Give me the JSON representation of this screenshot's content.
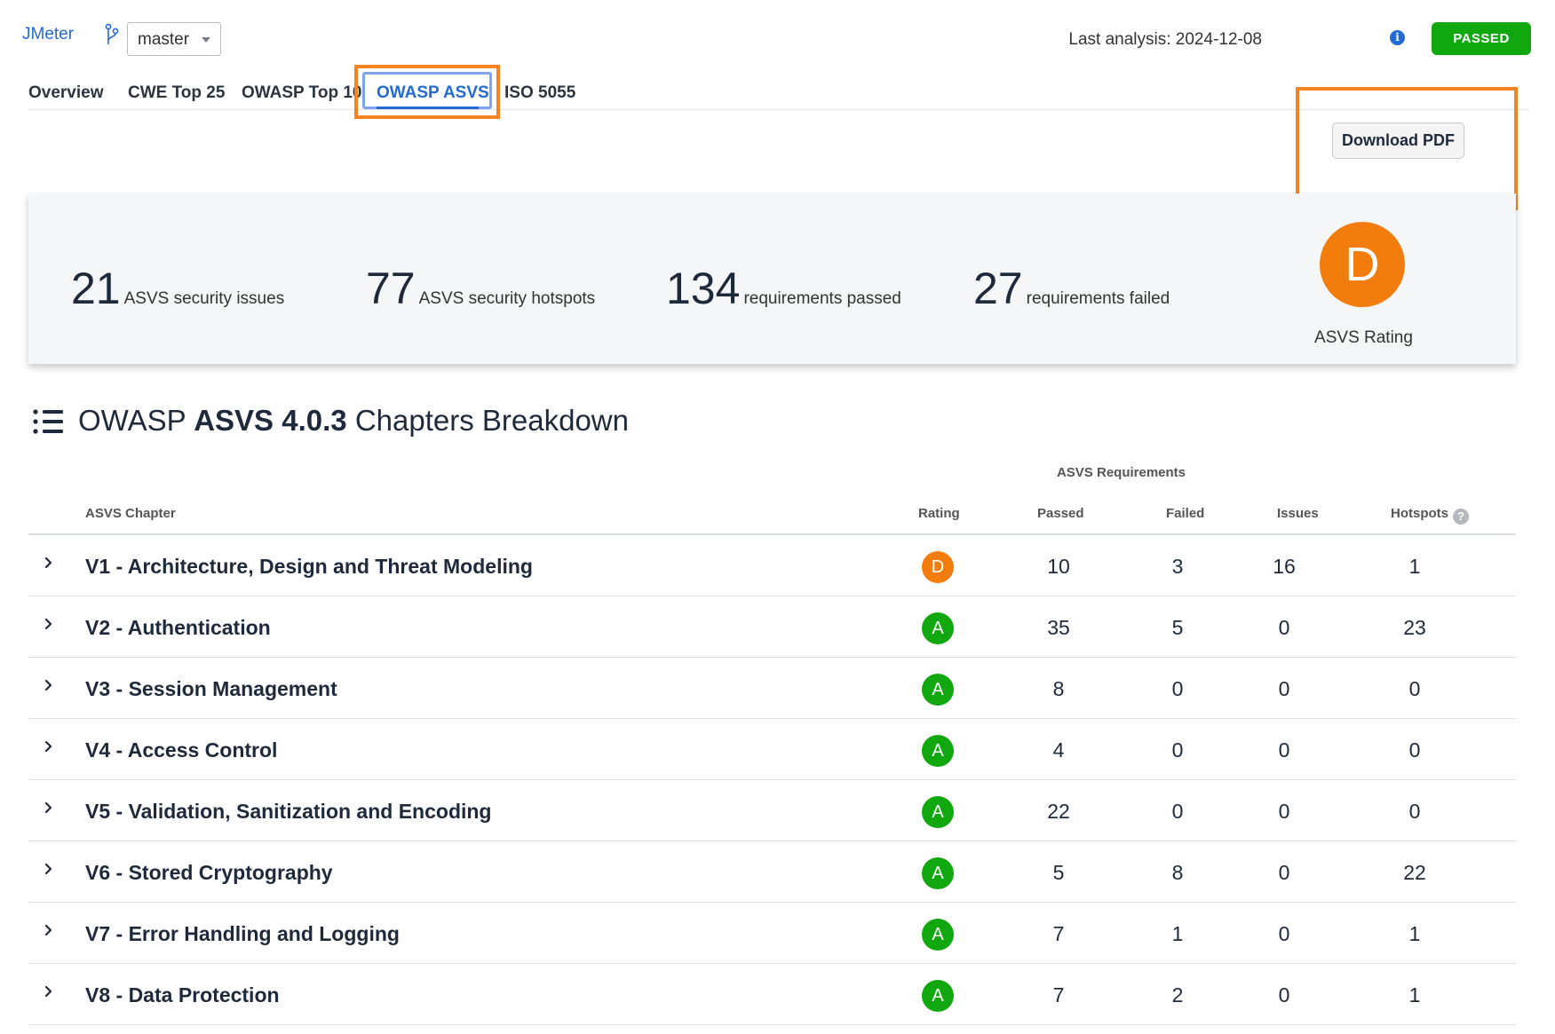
{
  "header": {
    "project": "JMeter",
    "branch": "master",
    "last_analysis": "Last analysis: 2024-12-08",
    "status": "PASSED"
  },
  "tabs": [
    {
      "label": "Overview",
      "active": false
    },
    {
      "label": "CWE Top 25",
      "active": false
    },
    {
      "label": "OWASP Top 10",
      "active": false
    },
    {
      "label": "OWASP ASVS",
      "active": true
    },
    {
      "label": "ISO 5055",
      "active": false
    }
  ],
  "download_pdf": "Download PDF",
  "summary": {
    "metrics": [
      {
        "value": "21",
        "label": "ASVS security issues"
      },
      {
        "value": "77",
        "label": "ASVS security hotspots"
      },
      {
        "value": "134",
        "label": "requirements passed"
      },
      {
        "value": "27",
        "label": "requirements failed"
      }
    ],
    "rating": "D",
    "rating_label": "ASVS Rating"
  },
  "section": {
    "prefix": "OWASP",
    "bold": "ASVS 4.0.3",
    "suffix": "Chapters Breakdown"
  },
  "table": {
    "group_header": "ASVS Requirements",
    "columns": {
      "chapter": "ASVS Chapter",
      "rating": "Rating",
      "passed": "Passed",
      "failed": "Failed",
      "issues": "Issues",
      "hotspots": "Hotspots"
    },
    "rows": [
      {
        "chapter": "V1 - Architecture, Design and Threat Modeling",
        "rating": "D",
        "passed": "10",
        "failed": "3",
        "issues": "16",
        "hotspots": "1"
      },
      {
        "chapter": "V2 - Authentication",
        "rating": "A",
        "passed": "35",
        "failed": "5",
        "issues": "0",
        "hotspots": "23"
      },
      {
        "chapter": "V3 - Session Management",
        "rating": "A",
        "passed": "8",
        "failed": "0",
        "issues": "0",
        "hotspots": "0"
      },
      {
        "chapter": "V4 - Access Control",
        "rating": "A",
        "passed": "4",
        "failed": "0",
        "issues": "0",
        "hotspots": "0"
      },
      {
        "chapter": "V5 - Validation, Sanitization and Encoding",
        "rating": "A",
        "passed": "22",
        "failed": "0",
        "issues": "0",
        "hotspots": "0"
      },
      {
        "chapter": "V6 - Stored Cryptography",
        "rating": "A",
        "passed": "5",
        "failed": "8",
        "issues": "0",
        "hotspots": "22"
      },
      {
        "chapter": "V7 - Error Handling and Logging",
        "rating": "A",
        "passed": "7",
        "failed": "1",
        "issues": "0",
        "hotspots": "1"
      },
      {
        "chapter": "V8 - Data Protection",
        "rating": "A",
        "passed": "7",
        "failed": "2",
        "issues": "0",
        "hotspots": "1"
      }
    ]
  },
  "colors": {
    "accent": "#236ad4",
    "passed": "#10a70f",
    "rating_a": "#10a70f",
    "rating_d": "#f27d0c",
    "highlight": "#f68321"
  },
  "icons": {
    "branch": "branch-icon",
    "info": "info-icon",
    "help": "help-icon",
    "list": "list-icon",
    "chevron": "chevron-right-icon"
  }
}
